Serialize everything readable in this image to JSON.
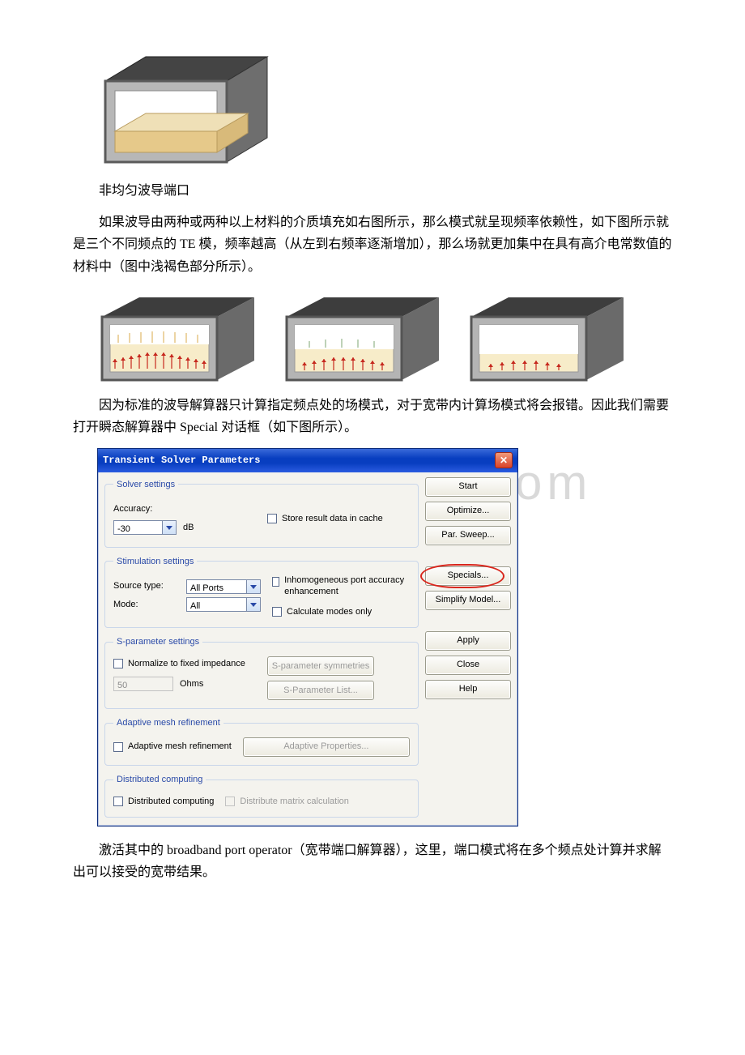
{
  "caption_single": "非均匀波导端口",
  "para1": "如果波导由两种或两种以上材料的介质填充如右图所示，那么模式就呈现频率依赖性，如下图所示就是三个不同频点的 TE 模，频率越高（从左到右频率逐渐增加），那么场就更加集中在具有高介电常数值的材料中（图中浅褐色部分所示）。",
  "para2": "因为标准的波导解算器只计算指定频点处的场模式，对于宽带内计算场模式将会报错。因此我们需要打开瞬态解算器中 Special 对话框（如下图所示）。",
  "para3": "激活其中的 broadband port operator（宽带端口解算器），这里，端口模式将在多个频点处计算并求解出可以接受的宽带结果。",
  "watermark": "www·bdocx·com",
  "dialog": {
    "title": "Transient Solver Parameters",
    "solver": {
      "legend": "Solver settings",
      "accuracy_label": "Accuracy:",
      "accuracy_value": "-30",
      "accuracy_unit": "dB",
      "store_cache": "Store result data in cache"
    },
    "stimulation": {
      "legend": "Stimulation settings",
      "source_label": "Source type:",
      "source_value": "All Ports",
      "mode_label": "Mode:",
      "mode_value": "All",
      "inhomo": "Inhomogeneous port accuracy enhancement",
      "calc_modes": "Calculate modes only"
    },
    "sparam": {
      "legend": "S-parameter settings",
      "normalize": "Normalize to fixed impedance",
      "imp_value": "50",
      "imp_unit": "Ohms",
      "sym_btn": "S-parameter symmetries",
      "list_btn": "S-Parameter List..."
    },
    "adaptive": {
      "legend": "Adaptive mesh refinement",
      "check": "Adaptive mesh refinement",
      "btn": "Adaptive Properties..."
    },
    "distributed": {
      "legend": "Distributed computing",
      "check": "Distributed computing",
      "btn": "Distribute matrix calculation"
    },
    "buttons": {
      "start": "Start",
      "optimize": "Optimize...",
      "parsweep": "Par. Sweep...",
      "specials": "Specials...",
      "simplify": "Simplify Model...",
      "apply": "Apply",
      "close": "Close",
      "help": "Help"
    }
  }
}
